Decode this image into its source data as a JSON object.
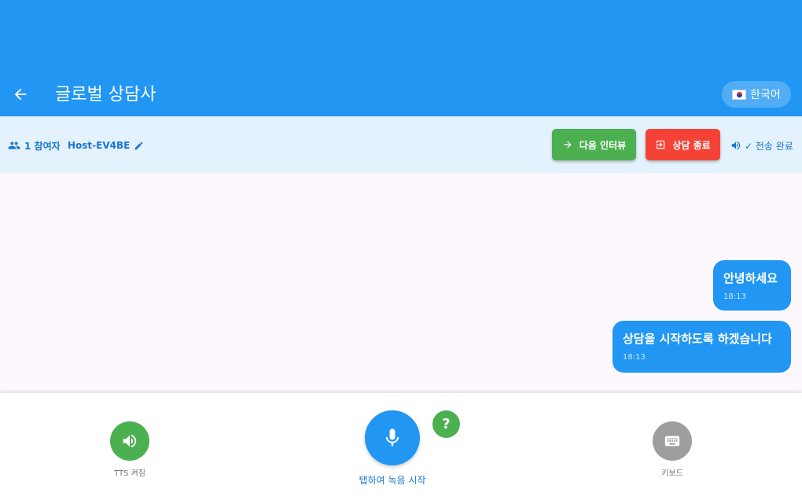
{
  "header": {
    "title": "글로벌 상담사",
    "back_icon": "arrow-back-icon",
    "language_label": "한국어",
    "language_flag": "south-korea-flag-icon"
  },
  "infobar": {
    "participants_label": "1 참여자",
    "host_label": "Host-EV4BE",
    "next_interview_label": "다음 인터뷰",
    "end_consultation_label": "상담 종료",
    "sent_status_label": "✓ 전송 완료"
  },
  "messages": [
    {
      "text": "안녕하세요",
      "time": "18:13"
    },
    {
      "text": "상담을 시작하도록 하겠습니다",
      "time": "18:13"
    }
  ],
  "controls": {
    "tts_label": "TTS 켜짐",
    "mic_label": "탭하여 녹음 시작",
    "help_label": "?",
    "keyboard_label": "키보드"
  },
  "colors": {
    "primary": "#2196f3",
    "success": "#4caf50",
    "danger": "#f44336",
    "infobar_bg": "#e3f2fd",
    "chat_bg": "#fdf7fe",
    "neutral": "#9e9e9e"
  }
}
